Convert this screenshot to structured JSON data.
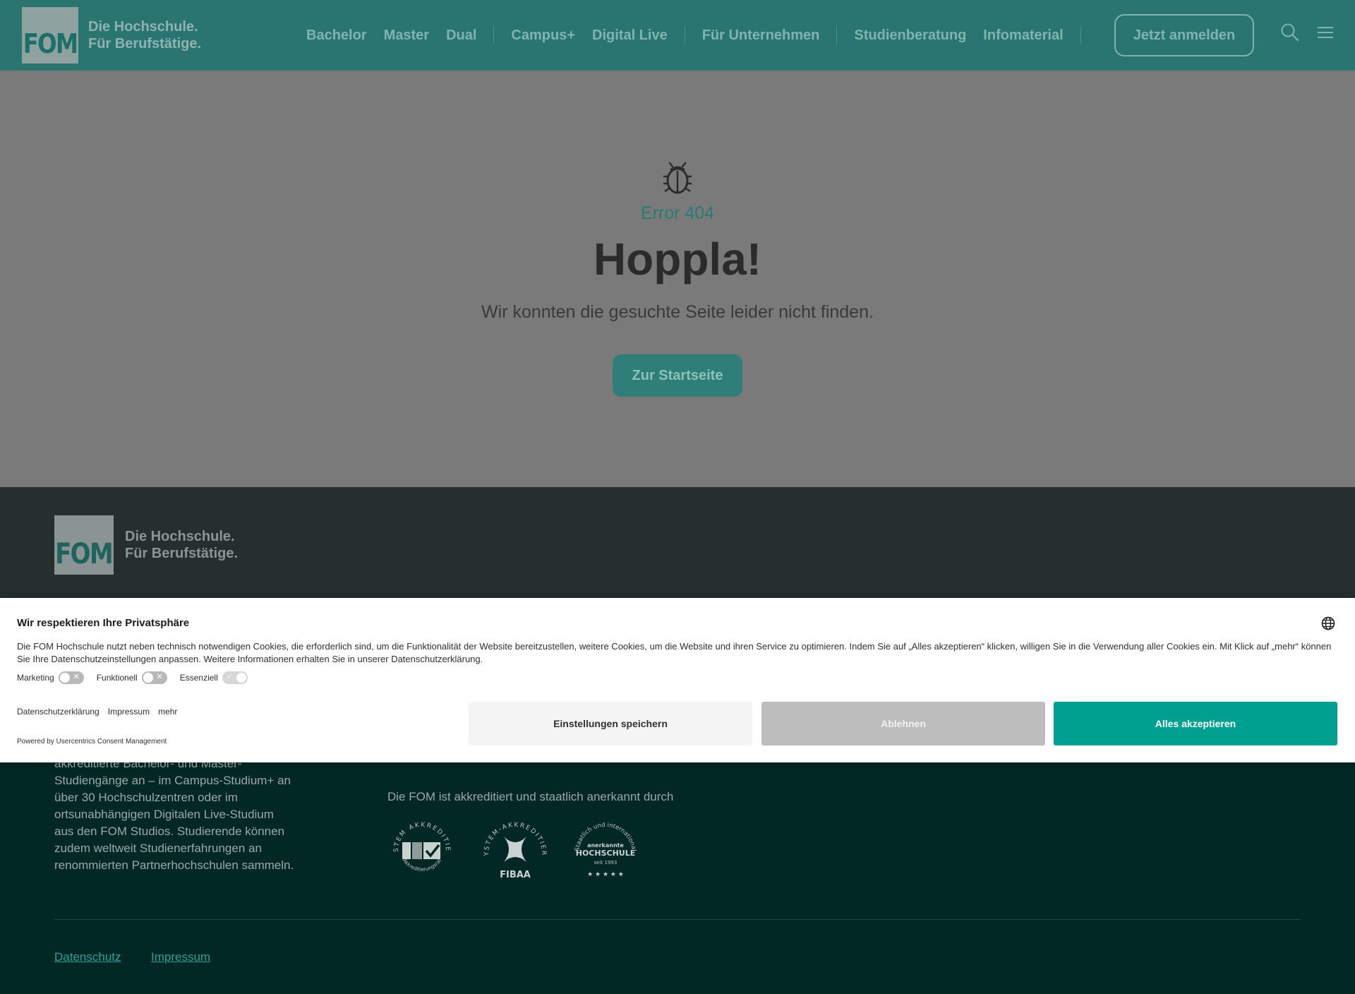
{
  "header": {
    "logo_mark": "FOM",
    "logo_line1": "Die Hochschule.",
    "logo_line2": "Für Berufstätige.",
    "nav": [
      "Bachelor",
      "Master",
      "Dual",
      "Campus+",
      "Digital Live",
      "Für Unternehmen",
      "Studienberatung",
      "Infomaterial"
    ],
    "cta": "Jetzt anmelden",
    "icons": [
      "search-icon",
      "menu-icon"
    ]
  },
  "error": {
    "icon": "bug-icon",
    "code": "Error 404",
    "title": "Hoppla!",
    "text": "Wir konnten die gesuchte Seite leider nicht finden.",
    "button": "Zur Startseite"
  },
  "footer": {
    "logo_mark": "FOM",
    "logo_line1": "Die Hochschule.",
    "logo_line2": "Für Berufstätige.",
    "description": "akkreditierte Bachelor- und Master-Studiengänge an – im Campus-Studium+ an über 30 Hochschulzentren oder im ortsunabhängigen Digitalen Live-Studium aus den FOM Studios. Studierende können zudem weltweit Studienerfahrungen an renommierten Partnerhochschulen sammeln.",
    "accreditation": "Die FOM ist akkreditiert und staatlich anerkannt durch",
    "seals": {
      "seal1_top": "SYSTEM AKKREDITIERT",
      "seal1_bottom": "Akkreditierungsrat",
      "seal2_top": "SYSTEM-AKKREDITIERT",
      "seal2_bottom": "FIBAA",
      "seal3_top": "Staatlich und international",
      "seal3_mid1": "anerkannte",
      "seal3_mid2": "HOCHSCHULE",
      "seal3_bottom": "seit 1993"
    },
    "links": [
      "Datenschutz",
      "Impressum"
    ]
  },
  "consent": {
    "title": "Wir respektieren Ihre Privatsphäre",
    "text": "Die FOM Hochschule nutzt neben technisch notwendigen Cookies, die erforderlich sind, um die Funktionalität der Website bereitzustellen, weitere Cookies, um die Website und ihren Service zu optimieren. Indem Sie auf „Alles akzeptieren“ klicken, willigen Sie in die Verwendung aller Cookies ein. Mit Klick auf „mehr“ können Sie Ihre Datenschutzeinstellungen anpassen. Weitere Informationen erhalten Sie in unserer Datenschutzerklärung.",
    "toggles": [
      {
        "label": "Marketing",
        "state": "off"
      },
      {
        "label": "Funktionell",
        "state": "off"
      },
      {
        "label": "Essenziell",
        "state": "on-disabled"
      }
    ],
    "links": [
      "Datenschutzerklärung",
      "Impressum",
      "mehr"
    ],
    "powered": "Powered by Usercentrics Consent Management",
    "btn_save": "Einstellungen speichern",
    "btn_deny": "Ablehnen",
    "btn_accept": "Alles akzeptieren",
    "colors": {
      "accept": "#00a091",
      "deny": "#bdbdbd",
      "save": "#f4f4f4"
    }
  },
  "colors": {
    "header_bg": "#2a7570",
    "overlay_bg": "#7a7a7a",
    "footer_bg": "#022826",
    "accent": "#2aa198"
  }
}
